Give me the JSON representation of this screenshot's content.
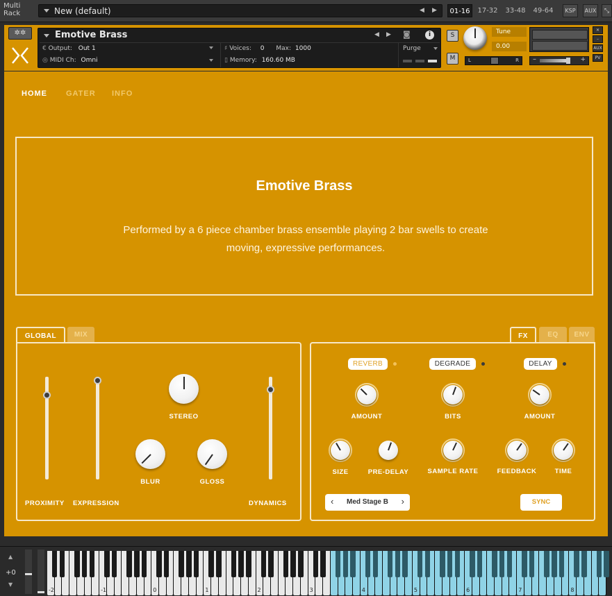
{
  "rack": {
    "label_line1": "Multi",
    "label_line2": "Rack",
    "preset_name": "New (default)",
    "pages": [
      "01-16",
      "17-32",
      "33-48",
      "49-64"
    ],
    "active_page": "01-16",
    "ksp_label": "KSP",
    "aux_label": "AUX"
  },
  "header": {
    "instrument_name": "Emotive Brass",
    "output_label": "Output:",
    "output_value": "Out 1",
    "midi_label": "MIDI Ch:",
    "midi_value": "Omni",
    "voices_label": "Voices:",
    "voices_value": "0",
    "max_label": "Max:",
    "max_value": "1000",
    "memory_label": "Memory:",
    "memory_value": "160.60 MB",
    "purge_label": "Purge",
    "solo_label": "S",
    "mute_label": "M",
    "tune_label": "Tune",
    "tune_value": "0.00",
    "pan_left": "L",
    "pan_right": "R",
    "aux_side": "AUX",
    "pv_side": "PV"
  },
  "nav": {
    "tabs": [
      {
        "label": "HOME",
        "active": true
      },
      {
        "label": "GATER",
        "active": false
      },
      {
        "label": "INFO",
        "active": false
      }
    ]
  },
  "info": {
    "title": "Emotive Brass",
    "description": "Performed by a 6 piece chamber brass ensemble playing 2 bar swells to create moving, expressive performances."
  },
  "global_panel": {
    "tabs": [
      "GLOBAL",
      "MIX"
    ],
    "active_tab": "GLOBAL",
    "sliders": [
      {
        "label": "PROXIMITY",
        "value": 0.83
      },
      {
        "label": "EXPRESSION",
        "value": 0.97
      },
      {
        "label": "DYNAMICS",
        "value": 0.87
      }
    ],
    "knobs": [
      {
        "label": "STEREO"
      },
      {
        "label": "BLUR"
      },
      {
        "label": "GLOSS"
      }
    ]
  },
  "fx_panel": {
    "tabs": [
      "FX",
      "EQ",
      "ENV"
    ],
    "active_tab": "FX",
    "reverb": {
      "label": "REVERB",
      "enabled": false,
      "knobs": [
        "AMOUNT",
        "SIZE",
        "PRE-DELAY"
      ],
      "preset": "Med Stage B"
    },
    "degrade": {
      "label": "DEGRADE",
      "enabled": true,
      "knobs": [
        "BITS",
        "SAMPLE RATE"
      ]
    },
    "delay": {
      "label": "DELAY",
      "enabled": true,
      "knobs": [
        "AMOUNT",
        "FEEDBACK",
        "TIME"
      ],
      "sync_label": "SYNC"
    }
  },
  "keyboard": {
    "octave_shift": "+0",
    "octave_labels": [
      "-2",
      "-1",
      "0",
      "1",
      "2",
      "3",
      "4",
      "5",
      "6",
      "7",
      "8"
    ]
  },
  "colors": {
    "panel": "#d69300",
    "accent_light": "#f7e8c7",
    "key_highlight": "#8fd3e6"
  }
}
